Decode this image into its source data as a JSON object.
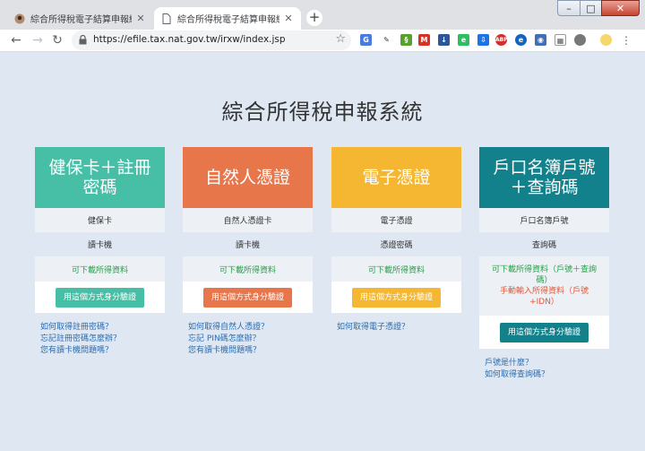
{
  "browser": {
    "tabs": [
      {
        "title": "綜合所得稅電子結算申報繳稅-開",
        "active": false
      },
      {
        "title": "綜合所得稅電子結算申報繳稅系",
        "active": true
      }
    ],
    "new_tab": "+",
    "url": "https://efile.tax.nat.gov.tw/irxw/index.jsp",
    "window_controls": {
      "minimize": "–",
      "maximize": "□",
      "close": "✕"
    },
    "extensions": [
      "translate-icon",
      "pen-icon",
      "evernote-like-icon",
      "gmail-icon",
      "download-icon",
      "evernote-icon",
      "download-arrow-icon",
      "adblock-icon",
      "translate-e-icon",
      "camera-icon",
      "grid-icon",
      "circle-icon",
      "avatar-icon",
      "menu-icon"
    ]
  },
  "page": {
    "title": "綜合所得稅申報系統"
  },
  "cards": [
    {
      "id": "health-card",
      "color": "#47bfa7",
      "title_line1": "健保卡＋註冊",
      "title_line2": "密碼",
      "row1": "健保卡",
      "row2": "讀卡機",
      "download": "可下載所得資料",
      "button": "用這個方式身分驗證",
      "links": [
        "如何取得註冊密碼？",
        "忘記註冊密碼怎麼辦？",
        "您有讀卡機問題嗎？"
      ]
    },
    {
      "id": "citizen-cert",
      "color": "#e8764b",
      "title_line1": "自然人憑證",
      "title_line2": "",
      "row1": "自然人憑證卡",
      "row2": "讀卡機",
      "download": "可下載所得資料",
      "button": "用這個方式身分驗證",
      "links": [
        "如何取得自然人憑證？",
        "忘記 PIN碼怎麼辦？",
        "您有讀卡機問題嗎？"
      ]
    },
    {
      "id": "e-cert",
      "color": "#f5b731",
      "title_line1": "電子憑證",
      "title_line2": "",
      "row1": "電子憑證",
      "row2": "憑證密碼",
      "download": "可下載所得資料",
      "button": "用這個方式身分驗證",
      "links": [
        "如何取得電子憑證？"
      ]
    },
    {
      "id": "household",
      "color": "#13818c",
      "title_line1": "戶口名簿戶號",
      "title_line2": "＋查詢碼",
      "row1": "戶口名簿戶號",
      "row2": "查詢碼",
      "download_line1": "可下載所得資料（戶號＋查詢",
      "download_line2": "碼）",
      "manual_line1": "手動輸入所得資料（戶號",
      "manual_line2": "+IDN）",
      "button": "用這個方式身分驗證",
      "links": [
        "戶號是什麼？",
        "如何取得查詢碼？"
      ]
    }
  ]
}
